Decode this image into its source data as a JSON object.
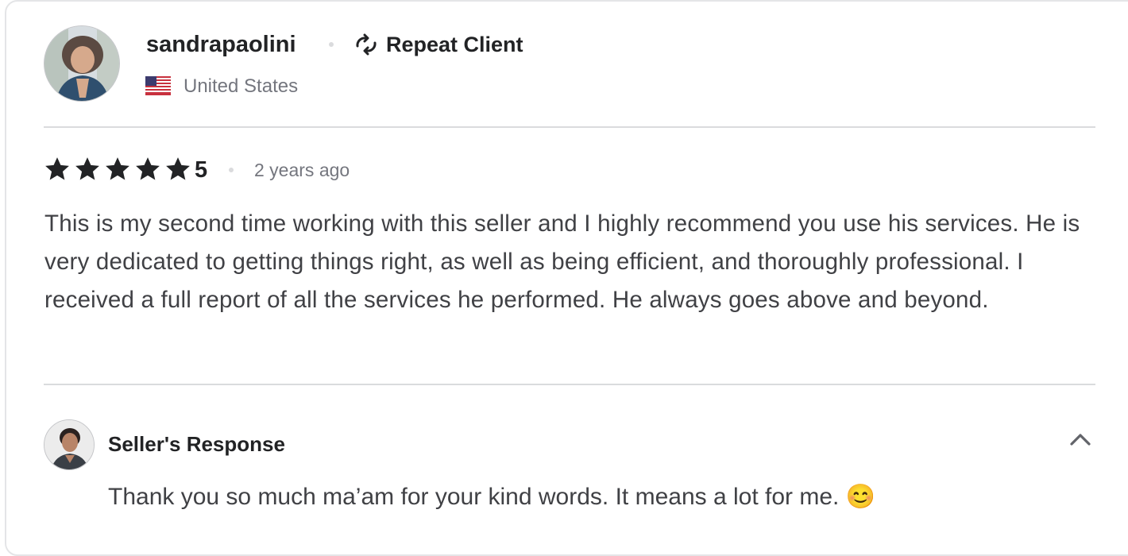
{
  "reviewer": {
    "username": "sandrapaolini",
    "badge_icon": "repeat-icon",
    "badge_label": "Repeat Client",
    "country_flag": "us-flag-icon",
    "country": "United States"
  },
  "review": {
    "stars": 5,
    "rating": "5",
    "time_ago": "2 years ago",
    "text": "This is my second time working with this seller and I highly recommend you use his services. He is very dedicated to getting things right, as well as being efficient, and thoroughly professional. I received a full report of all the services he performed. He always goes above and beyond."
  },
  "seller_response": {
    "title": "Seller's Response",
    "text": "Thank you so much ma’am for your kind words. It means a lot for me. 😊",
    "toggle_icon": "chevron-up-icon"
  },
  "colors": {
    "star": "#222325",
    "divider": "#dadbdd",
    "muted_text": "#74767e",
    "body_text": "#404145",
    "heading_text": "#222325"
  }
}
